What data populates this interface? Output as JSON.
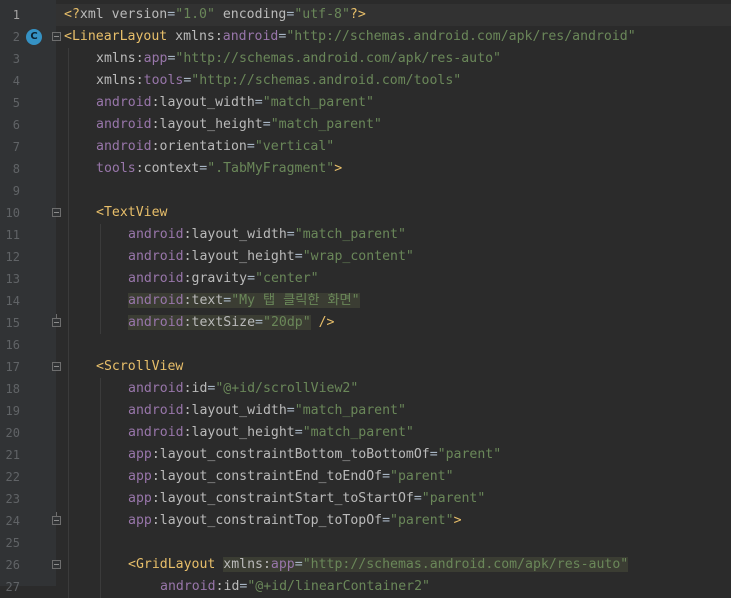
{
  "editor": {
    "class_marker_label": "C",
    "lines": [
      {
        "n": "1",
        "current": true,
        "indent": 0,
        "fold": "",
        "tokens": [
          {
            "t": "<?",
            "c": "pi"
          },
          {
            "t": "xml ",
            "c": "attr"
          },
          {
            "t": "version",
            "c": "attr"
          },
          {
            "t": "=",
            "c": "plain"
          },
          {
            "t": "\"1.0\"",
            "c": "val"
          },
          {
            "t": " ",
            "c": "plain"
          },
          {
            "t": "encoding",
            "c": "attr"
          },
          {
            "t": "=",
            "c": "plain"
          },
          {
            "t": "\"utf-8\"",
            "c": "val"
          },
          {
            "t": "?>",
            "c": "pi"
          }
        ]
      },
      {
        "n": "2",
        "indent": 0,
        "fold": "start",
        "marker": true,
        "tokens": [
          {
            "t": "<LinearLayout ",
            "c": "tag"
          },
          {
            "t": "xmlns:",
            "c": "attr"
          },
          {
            "t": "android",
            "c": "ns"
          },
          {
            "t": "=",
            "c": "plain"
          },
          {
            "t": "\"http://schemas.android.com/apk/res/android\"",
            "c": "val"
          }
        ]
      },
      {
        "n": "3",
        "indent": 1,
        "fold": "",
        "tokens": [
          {
            "t": "xmlns:",
            "c": "attr"
          },
          {
            "t": "app",
            "c": "ns"
          },
          {
            "t": "=",
            "c": "plain"
          },
          {
            "t": "\"http://schemas.android.com/apk/res-auto\"",
            "c": "val"
          }
        ]
      },
      {
        "n": "4",
        "indent": 1,
        "fold": "",
        "tokens": [
          {
            "t": "xmlns:",
            "c": "attr"
          },
          {
            "t": "tools",
            "c": "ns"
          },
          {
            "t": "=",
            "c": "plain"
          },
          {
            "t": "\"http://schemas.android.com/tools\"",
            "c": "val"
          }
        ]
      },
      {
        "n": "5",
        "indent": 1,
        "fold": "",
        "tokens": [
          {
            "t": "android",
            "c": "ns"
          },
          {
            "t": ":layout_width",
            "c": "attr"
          },
          {
            "t": "=",
            "c": "plain"
          },
          {
            "t": "\"match_parent\"",
            "c": "val"
          }
        ]
      },
      {
        "n": "6",
        "indent": 1,
        "fold": "",
        "tokens": [
          {
            "t": "android",
            "c": "ns"
          },
          {
            "t": ":layout_height",
            "c": "attr"
          },
          {
            "t": "=",
            "c": "plain"
          },
          {
            "t": "\"match_parent\"",
            "c": "val"
          }
        ]
      },
      {
        "n": "7",
        "indent": 1,
        "fold": "",
        "tokens": [
          {
            "t": "android",
            "c": "ns"
          },
          {
            "t": ":orientation",
            "c": "attr"
          },
          {
            "t": "=",
            "c": "plain"
          },
          {
            "t": "\"vertical\"",
            "c": "val"
          }
        ]
      },
      {
        "n": "8",
        "indent": 1,
        "fold": "",
        "tokens": [
          {
            "t": "tools",
            "c": "ns"
          },
          {
            "t": ":context",
            "c": "attr"
          },
          {
            "t": "=",
            "c": "plain"
          },
          {
            "t": "\".TabMyFragment\"",
            "c": "val"
          },
          {
            "t": ">",
            "c": "tag"
          }
        ]
      },
      {
        "n": "9",
        "indent": 0,
        "fold": "",
        "tokens": []
      },
      {
        "n": "10",
        "indent": 1,
        "fold": "start",
        "tokens": [
          {
            "t": "<TextView",
            "c": "tag"
          }
        ]
      },
      {
        "n": "11",
        "indent": 2,
        "fold": "",
        "tokens": [
          {
            "t": "android",
            "c": "ns"
          },
          {
            "t": ":layout_width",
            "c": "attr"
          },
          {
            "t": "=",
            "c": "plain"
          },
          {
            "t": "\"match_parent\"",
            "c": "val"
          }
        ]
      },
      {
        "n": "12",
        "indent": 2,
        "fold": "",
        "tokens": [
          {
            "t": "android",
            "c": "ns"
          },
          {
            "t": ":layout_height",
            "c": "attr"
          },
          {
            "t": "=",
            "c": "plain"
          },
          {
            "t": "\"wrap_content\"",
            "c": "val"
          }
        ]
      },
      {
        "n": "13",
        "indent": 2,
        "fold": "",
        "tokens": [
          {
            "t": "android",
            "c": "ns"
          },
          {
            "t": ":gravity",
            "c": "attr"
          },
          {
            "t": "=",
            "c": "plain"
          },
          {
            "t": "\"center\"",
            "c": "val"
          }
        ]
      },
      {
        "n": "14",
        "indent": 2,
        "fold": "",
        "highlight": true,
        "tokens": [
          {
            "t": "android",
            "c": "ns"
          },
          {
            "t": ":text",
            "c": "attr"
          },
          {
            "t": "=",
            "c": "plain"
          },
          {
            "t": "\"My 탭 클릭한 화면\"",
            "c": "val"
          }
        ]
      },
      {
        "n": "15",
        "indent": 2,
        "fold": "end",
        "highlight": true,
        "highlight_tokens": 4,
        "tokens": [
          {
            "t": "android",
            "c": "ns"
          },
          {
            "t": ":textSize",
            "c": "attr"
          },
          {
            "t": "=",
            "c": "plain"
          },
          {
            "t": "\"20dp\"",
            "c": "val"
          },
          {
            "t": " />",
            "c": "tag"
          }
        ]
      },
      {
        "n": "16",
        "indent": 0,
        "fold": "",
        "tokens": []
      },
      {
        "n": "17",
        "indent": 1,
        "fold": "start",
        "tokens": [
          {
            "t": "<ScrollView",
            "c": "tag"
          }
        ]
      },
      {
        "n": "18",
        "indent": 2,
        "fold": "",
        "tokens": [
          {
            "t": "android",
            "c": "ns"
          },
          {
            "t": ":id",
            "c": "attr"
          },
          {
            "t": "=",
            "c": "plain"
          },
          {
            "t": "\"@+id/scrollView2\"",
            "c": "val"
          }
        ]
      },
      {
        "n": "19",
        "indent": 2,
        "fold": "",
        "tokens": [
          {
            "t": "android",
            "c": "ns"
          },
          {
            "t": ":layout_width",
            "c": "attr"
          },
          {
            "t": "=",
            "c": "plain"
          },
          {
            "t": "\"match_parent\"",
            "c": "val"
          }
        ]
      },
      {
        "n": "20",
        "indent": 2,
        "fold": "",
        "tokens": [
          {
            "t": "android",
            "c": "ns"
          },
          {
            "t": ":layout_height",
            "c": "attr"
          },
          {
            "t": "=",
            "c": "plain"
          },
          {
            "t": "\"match_parent\"",
            "c": "val"
          }
        ]
      },
      {
        "n": "21",
        "indent": 2,
        "fold": "",
        "tokens": [
          {
            "t": "app",
            "c": "ns"
          },
          {
            "t": ":layout_constraintBottom_toBottomOf",
            "c": "attr"
          },
          {
            "t": "=",
            "c": "plain"
          },
          {
            "t": "\"parent\"",
            "c": "val"
          }
        ]
      },
      {
        "n": "22",
        "indent": 2,
        "fold": "",
        "tokens": [
          {
            "t": "app",
            "c": "ns"
          },
          {
            "t": ":layout_constraintEnd_toEndOf",
            "c": "attr"
          },
          {
            "t": "=",
            "c": "plain"
          },
          {
            "t": "\"parent\"",
            "c": "val"
          }
        ]
      },
      {
        "n": "23",
        "indent": 2,
        "fold": "",
        "tokens": [
          {
            "t": "app",
            "c": "ns"
          },
          {
            "t": ":layout_constraintStart_toStartOf",
            "c": "attr"
          },
          {
            "t": "=",
            "c": "plain"
          },
          {
            "t": "\"parent\"",
            "c": "val"
          }
        ]
      },
      {
        "n": "24",
        "indent": 2,
        "fold": "end",
        "tokens": [
          {
            "t": "app",
            "c": "ns"
          },
          {
            "t": ":layout_constraintTop_toTopOf",
            "c": "attr"
          },
          {
            "t": "=",
            "c": "plain"
          },
          {
            "t": "\"parent\"",
            "c": "val"
          },
          {
            "t": ">",
            "c": "tag"
          }
        ]
      },
      {
        "n": "25",
        "indent": 0,
        "fold": "",
        "tokens": []
      },
      {
        "n": "26",
        "indent": 2,
        "fold": "start",
        "highlight": true,
        "highlight_from": 1,
        "tokens": [
          {
            "t": "<GridLayout ",
            "c": "tag"
          },
          {
            "t": "xmlns:",
            "c": "attr"
          },
          {
            "t": "app",
            "c": "ns"
          },
          {
            "t": "=",
            "c": "plain"
          },
          {
            "t": "\"http://schemas.android.com/apk/res-auto\"",
            "c": "val"
          }
        ]
      },
      {
        "n": "27",
        "indent": 3,
        "fold": "",
        "tokens": [
          {
            "t": "android",
            "c": "ns"
          },
          {
            "t": ":id",
            "c": "attr"
          },
          {
            "t": "=",
            "c": "plain"
          },
          {
            "t": "\"@+id/linearContainer2\"",
            "c": "val"
          }
        ]
      }
    ]
  }
}
